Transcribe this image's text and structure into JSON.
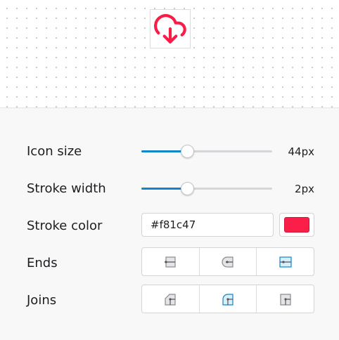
{
  "preview": {
    "icon_name": "cloud-download-icon",
    "stroke_color": "#f81c47"
  },
  "controls": {
    "icon_size": {
      "label": "Icon size",
      "value_text": "44px",
      "fraction": 0.35
    },
    "stroke_width": {
      "label": "Stroke width",
      "value_text": "2px",
      "fraction": 0.35
    },
    "stroke_color": {
      "label": "Stroke color",
      "value": "#f81c47",
      "swatch_color": "#fb1e49"
    },
    "ends": {
      "label": "Ends",
      "options": [
        {
          "icon": "butt-cap-icon",
          "selected": false
        },
        {
          "icon": "round-cap-icon",
          "selected": false
        },
        {
          "icon": "square-cap-icon",
          "selected": true
        }
      ]
    },
    "joins": {
      "label": "Joins",
      "options": [
        {
          "icon": "bevel-join-icon",
          "selected": false
        },
        {
          "icon": "round-join-icon",
          "selected": true
        },
        {
          "icon": "miter-join-icon",
          "selected": false
        }
      ]
    }
  },
  "colors": {
    "accent": "#1187c9",
    "selected_fill": "#d7eefc"
  }
}
